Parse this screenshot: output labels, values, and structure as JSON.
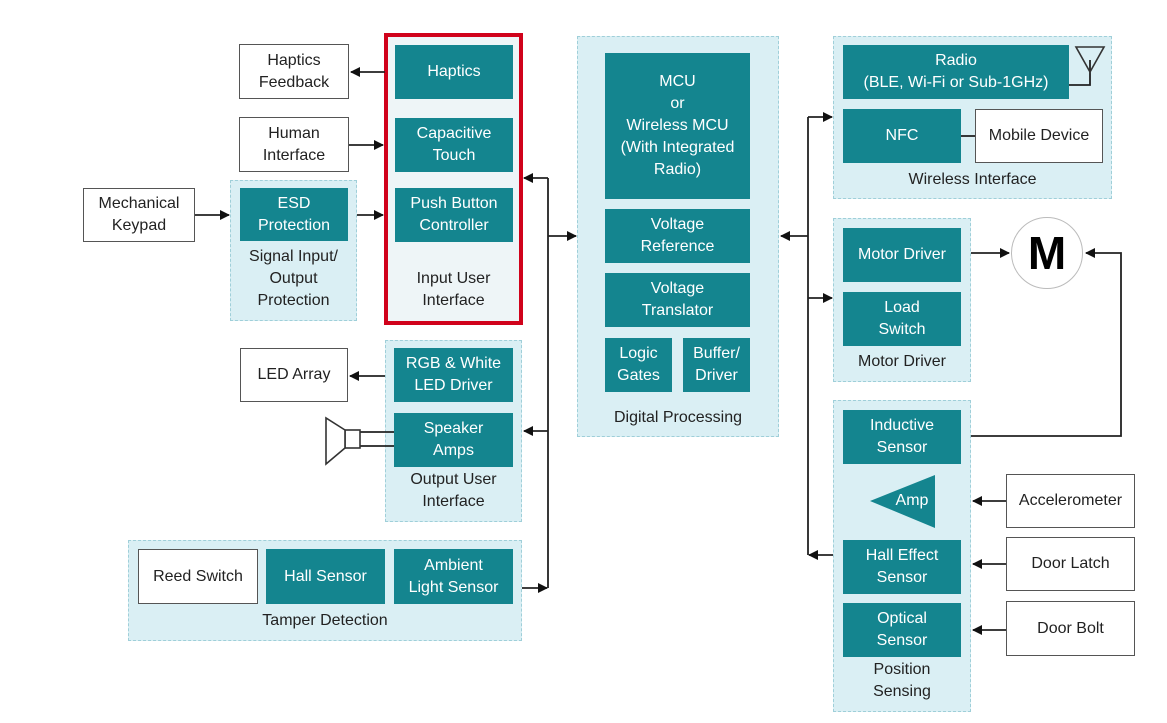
{
  "colors": {
    "block": "#14858f",
    "group": "#daeff4",
    "highlight": "#d0021b"
  },
  "external": {
    "haptics_feedback": "Haptics\nFeedback",
    "human_interface": "Human\nInterface",
    "mechanical_keypad": "Mechanical\nKeypad",
    "led_array": "LED Array",
    "reed_switch": "Reed Switch",
    "mobile_device": "Mobile Device",
    "motor": "M",
    "accelerometer": "Accelerometer",
    "door_latch": "Door Latch",
    "door_bolt": "Door Bolt"
  },
  "signal_protection": {
    "blocks": [
      "ESD\nProtection"
    ],
    "label": "Signal Input/\nOutput\nProtection"
  },
  "input_ui": {
    "blocks": [
      "Haptics",
      "Capacitive\nTouch",
      "Push Button\nController"
    ],
    "label": "Input User\nInterface"
  },
  "output_ui": {
    "blocks": [
      "RGB & White\nLED Driver",
      "Speaker\nAmps"
    ],
    "label": "Output User\nInterface"
  },
  "tamper": {
    "blocks": [
      "Hall Sensor",
      "Ambient\nLight Sensor"
    ],
    "label": "Tamper Detection"
  },
  "digital": {
    "blocks": [
      "MCU\nor\nWireless MCU\n(With Integrated\nRadio)",
      "Voltage\nReference",
      "Voltage\nTranslator",
      "Logic\nGates",
      "Buffer/\nDriver"
    ],
    "label": "Digital Processing"
  },
  "wireless": {
    "blocks": [
      "Radio\n(BLE, Wi-Fi or Sub-1GHz)",
      "NFC"
    ],
    "label": "Wireless Interface"
  },
  "motor_driver": {
    "blocks": [
      "Motor Driver",
      "Load\nSwitch"
    ],
    "label": "Motor Driver"
  },
  "position": {
    "blocks": [
      "Inductive\nSensor",
      "Amp",
      "Hall Effect\nSensor",
      "Optical\nSensor"
    ],
    "label": "Position\nSensing"
  }
}
